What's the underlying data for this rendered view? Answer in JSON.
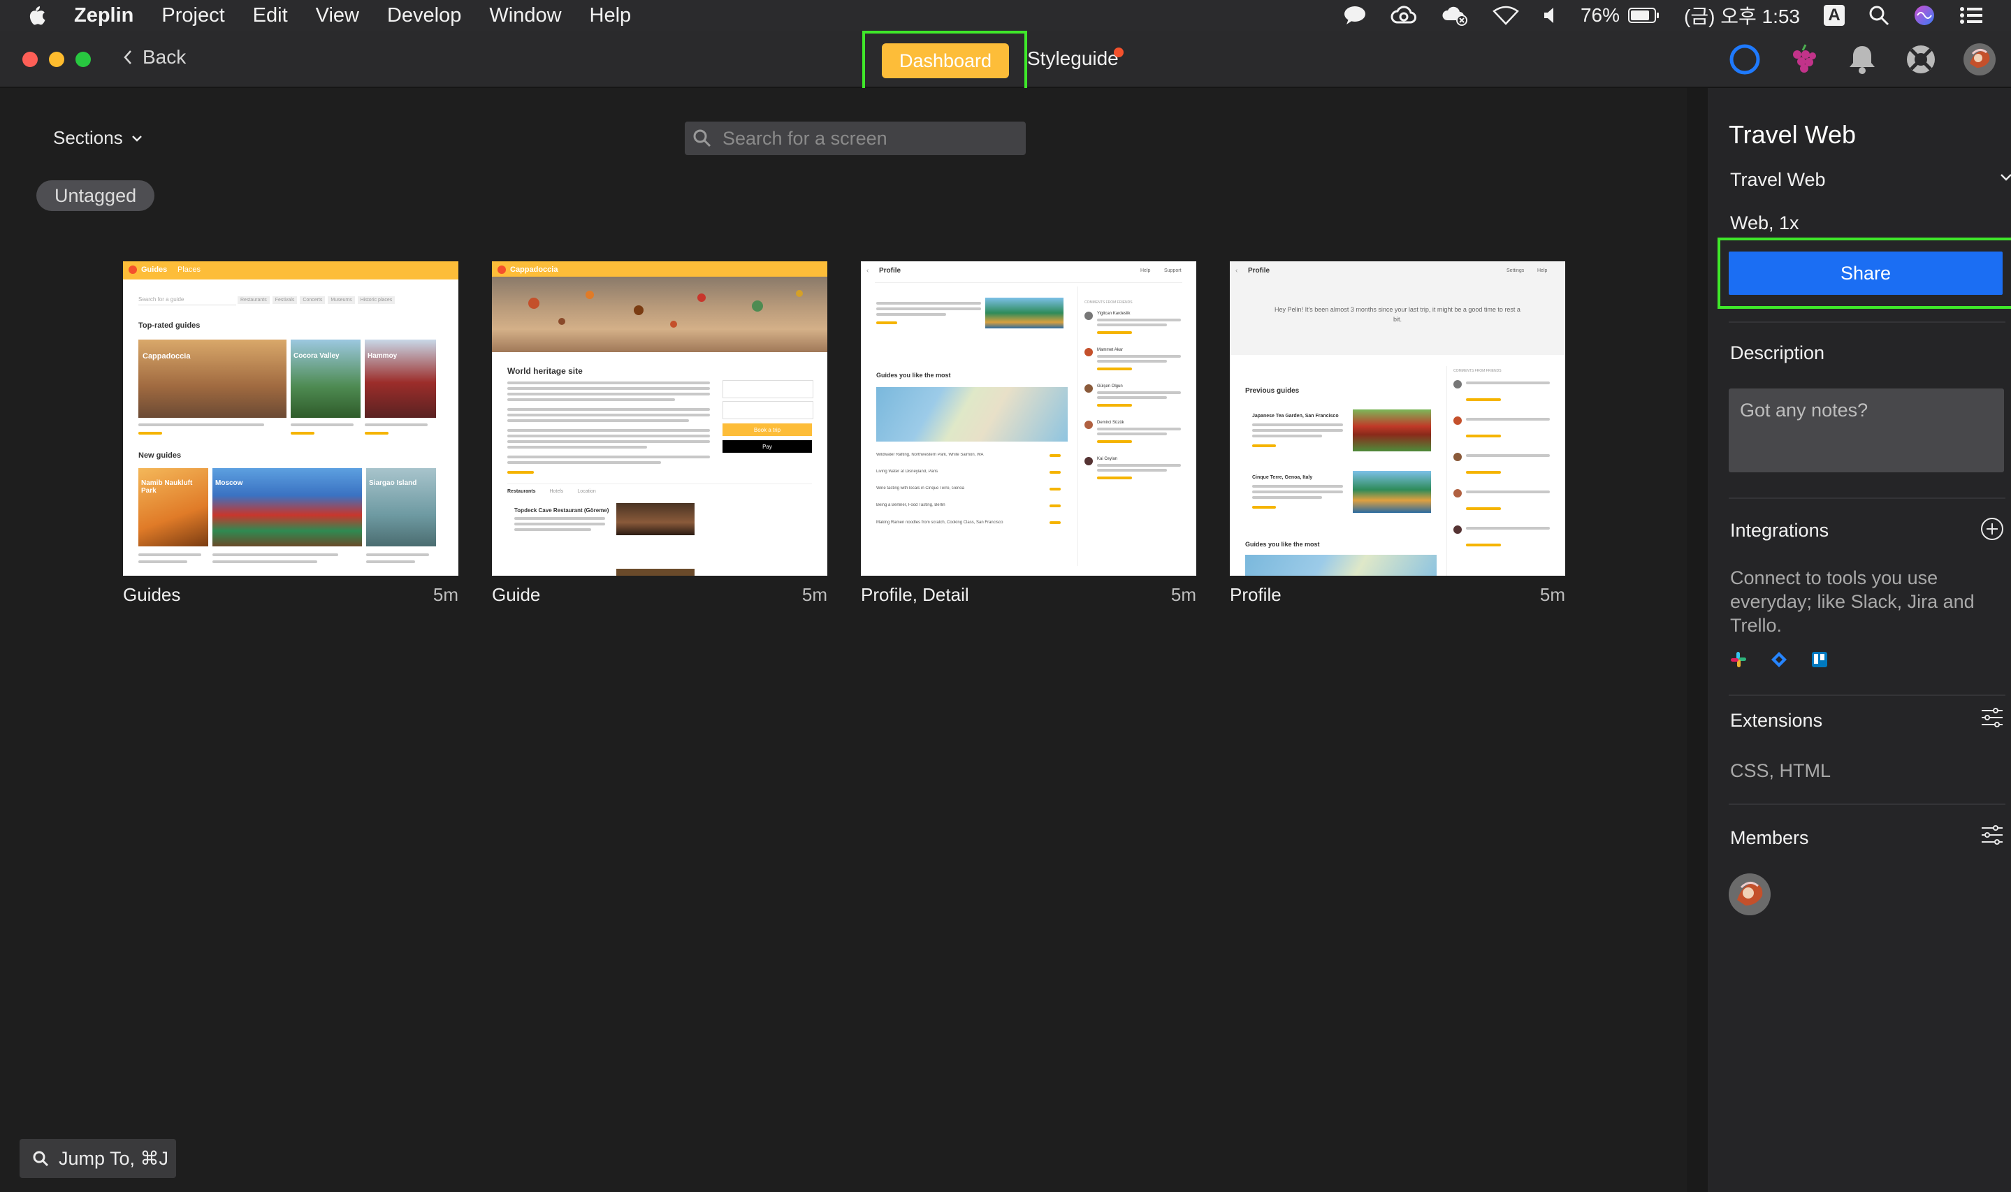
{
  "menubar": {
    "app_name": "Zeplin",
    "items": [
      "Project",
      "Edit",
      "View",
      "Develop",
      "Window",
      "Help"
    ],
    "battery": "76%",
    "datetime": "(금) 오후 1:53",
    "input_source": "A",
    "icons": [
      "apple-icon",
      "messages-icon",
      "creative-cloud-icon",
      "cloud-icon",
      "wifi-icon",
      "volume-icon",
      "battery-icon",
      "input-source-icon",
      "spotlight-icon",
      "siri-icon",
      "control-center-icon"
    ]
  },
  "toolbar": {
    "back_label": "Back",
    "tabs": {
      "dashboard": "Dashboard",
      "styleguide": "Styleguide"
    },
    "colors": {
      "dashboard": "#fdbd39",
      "notification_dot": "#f4512c",
      "highlight": "#3fe72a"
    },
    "icons": [
      "activity-ring-icon",
      "grape-icon",
      "notifications-bell-icon",
      "help-lifebuoy-icon",
      "user-avatar"
    ]
  },
  "main": {
    "sections_label": "Sections",
    "search_placeholder": "Search for a screen",
    "tag": "Untagged",
    "screens": [
      {
        "name": "Guides",
        "time": "5m"
      },
      {
        "name": "Guide",
        "time": "5m"
      },
      {
        "name": "Profile, Detail",
        "time": "5m"
      },
      {
        "name": "Profile",
        "time": "5m"
      }
    ],
    "jump_label": "Jump To, ⌘J"
  },
  "thumbs": {
    "guides": {
      "logo": "Guides",
      "nav2": "Places",
      "search": "Search for a guide",
      "filters": [
        "Restaurants",
        "Festivals",
        "Concerts",
        "Museums",
        "Historic places"
      ],
      "top_rated": "Top-rated guides",
      "cards_top": [
        "Cappadoccia",
        "Cocora Valley",
        "Hammoy"
      ],
      "new_guides": "New guides",
      "cards_new": [
        "Namib Naukluft Park",
        "Moscow",
        "Siargao Island"
      ]
    },
    "guide": {
      "logo": "Cappadoccia",
      "heading": "World heritage site",
      "book": "Book a trip",
      "pay": " Pay",
      "tabs": [
        "Restaurants",
        "Hotels",
        "Location"
      ],
      "place": "Topdeck Cave Restaurant (Göreme)"
    },
    "profile_detail": {
      "title": "Profile",
      "nav": [
        "Help",
        "Support"
      ],
      "section": "Guides you like the most",
      "comments": "COMMENTS FROM FRIENDS",
      "people": [
        "Yigitcan Kardeslik",
        "Mammet Akar",
        "Gülşen Olgun",
        "Demirci Süzük",
        "Kai Ceylan"
      ],
      "list": [
        "Wildwater Rafting, Northwestern Park, White Salmon, WA",
        "Living Water at Disneyland, Paris",
        "Wine tasting with locals in Cinque Terre, Genoa",
        "Being a Berliner, Food Tasting, Berlin",
        "Making Ramen noodles from scratch, Cooking Class, San Francisco"
      ]
    },
    "profile": {
      "title": "Profile",
      "nav": [
        "Settings",
        "Help"
      ],
      "greeting": "Hey Pelin! It's been almost 3 months since your last trip, it might be a good time to rest a bit.",
      "section": "Previous guides",
      "guides": [
        "Japanese Tea Garden, San Francisco",
        "Cinque Terre, Genoa, Italy"
      ],
      "section2": "Guides you like the most",
      "comments": "COMMENTS FROM FRIENDS"
    }
  },
  "panel": {
    "title": "Travel Web",
    "project": "Travel Web",
    "platform": "Web, 1x",
    "share": "Share",
    "description_heading": "Description",
    "notes_placeholder": "Got any notes?",
    "integrations_heading": "Integrations",
    "integrations_text": "Connect to tools you use everyday; like Slack, Jira and Trello.",
    "integration_icons": [
      "slack-icon",
      "jira-icon",
      "trello-icon"
    ],
    "extensions_heading": "Extensions",
    "extensions_text": "CSS, HTML",
    "members_heading": "Members"
  }
}
